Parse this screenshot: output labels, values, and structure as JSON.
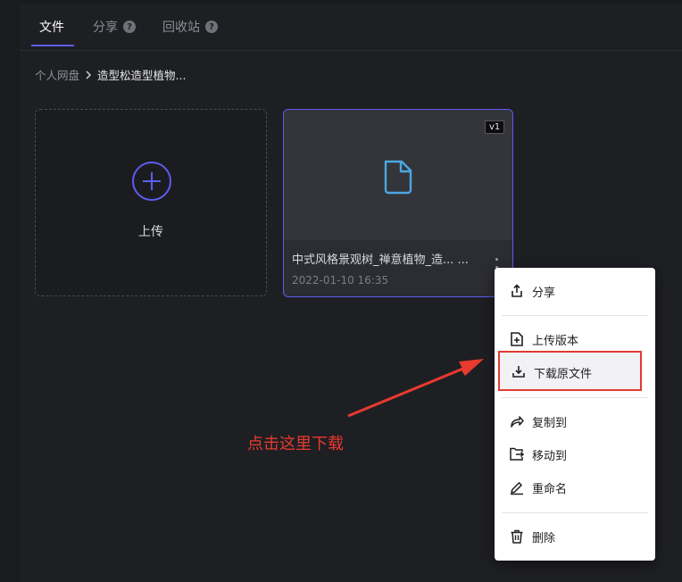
{
  "tabs": [
    {
      "label": "文件",
      "active": true
    },
    {
      "label": "分享",
      "help": "?"
    },
    {
      "label": "回收站",
      "help": "?"
    }
  ],
  "breadcrumb": {
    "root": "个人网盘",
    "current": "造型松造型植物..."
  },
  "upload": {
    "label": "上传"
  },
  "file": {
    "name": "中式风格景观树_禅意植物_造... ...",
    "date": "2022-01-10 16:35",
    "version": "v1",
    "icon": "file-icon"
  },
  "menu": {
    "items": [
      {
        "label": "分享",
        "icon": "share-icon"
      },
      {
        "label": "上传版本",
        "icon": "file-plus-icon"
      },
      {
        "label": "下载原文件",
        "icon": "download-icon"
      },
      {
        "label": "复制到",
        "icon": "copy-forward-icon"
      },
      {
        "label": "移动到",
        "icon": "move-icon"
      },
      {
        "label": "重命名",
        "icon": "pencil-icon"
      },
      {
        "label": "删除",
        "icon": "trash-icon"
      }
    ]
  },
  "annotation": {
    "text": "点击这里下载"
  },
  "colors": {
    "accent": "#5d5cf0",
    "highlight": "#e03a30",
    "file_icon": "#4aa8e0"
  }
}
